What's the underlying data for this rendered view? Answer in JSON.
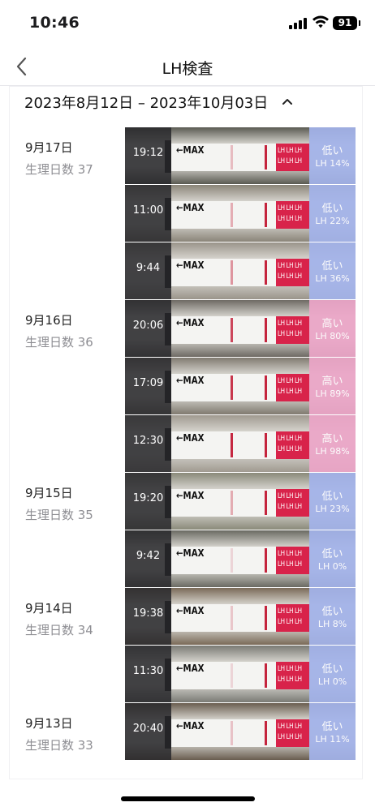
{
  "status_bar": {
    "time": "10:46",
    "battery": "91"
  },
  "nav": {
    "title": "LH検査"
  },
  "range": {
    "text": "2023年8月12日 – 2023年10月03日"
  },
  "days": [
    {
      "date": "9月17日",
      "cycle": "生理日数 37"
    },
    {
      "date": "9月16日",
      "cycle": "生理日数 36"
    },
    {
      "date": "9月15日",
      "cycle": "生理日数 35"
    },
    {
      "date": "9月14日",
      "cycle": "生理日数 34"
    },
    {
      "date": "9月13日",
      "cycle": "生理日数 33"
    }
  ],
  "strip_max_label": "MAX",
  "strip_band_label": "LH LH LH",
  "tests": [
    {
      "time": "19:12",
      "level": "低い",
      "lh": "LH 14%",
      "lh_value": 14
    },
    {
      "time": "11:00",
      "level": "低い",
      "lh": "LH 22%",
      "lh_value": 22
    },
    {
      "time": "9:44",
      "level": "低い",
      "lh": "LH 36%",
      "lh_value": 36
    },
    {
      "time": "20:06",
      "level": "高い",
      "lh": "LH 80%",
      "lh_value": 80
    },
    {
      "time": "17:09",
      "level": "高い",
      "lh": "LH 89%",
      "lh_value": 89
    },
    {
      "time": "12:30",
      "level": "高い",
      "lh": "LH 98%",
      "lh_value": 98
    },
    {
      "time": "19:20",
      "level": "低い",
      "lh": "LH 23%",
      "lh_value": 23
    },
    {
      "time": "9:42",
      "level": "低い",
      "lh": "LH 0%",
      "lh_value": 0
    },
    {
      "time": "19:38",
      "level": "低い",
      "lh": "LH 8%",
      "lh_value": 8
    },
    {
      "time": "11:30",
      "level": "低い",
      "lh": "LH 0%",
      "lh_value": 0
    },
    {
      "time": "20:40",
      "level": "低い",
      "lh": "LH 11%",
      "lh_value": 11
    }
  ],
  "colors": {
    "low_panel": "#a3b3ea",
    "high_panel": "#eca6c8",
    "control_line": "#c4243d",
    "band": "#d8234a"
  }
}
